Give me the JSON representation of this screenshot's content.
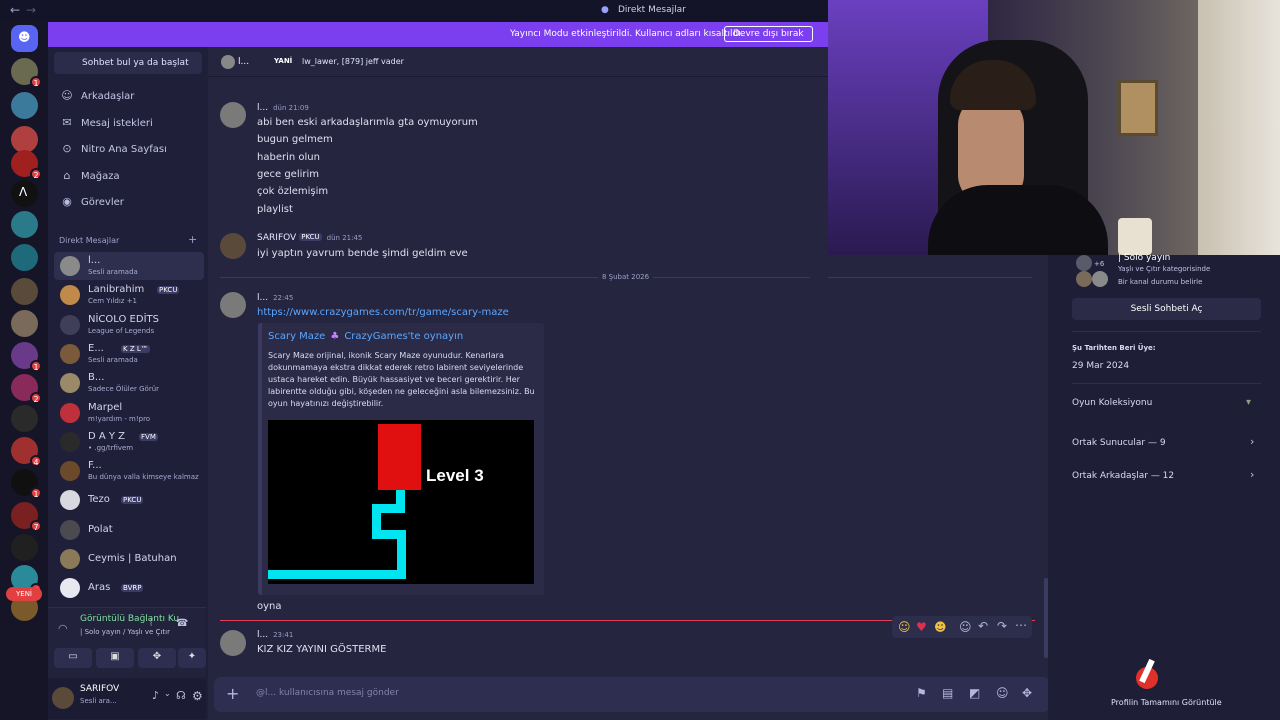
{
  "window": {
    "title": "Direkt Mesajlar"
  },
  "banner": {
    "text": "Yayıncı Modu etkinleştirildi. Kullanıcı adları kısaltıldı.",
    "button": "Devre dışı bırak"
  },
  "sidebar": {
    "search": "Sohbet bul ya da başlat",
    "nav": [
      {
        "label": "Arkadaşlar",
        "icon": "friends-icon",
        "glyph": "☺"
      },
      {
        "label": "Mesaj istekleri",
        "icon": "mail-icon",
        "glyph": "✉"
      },
      {
        "label": "Nitro Ana Sayfası",
        "icon": "nitro-icon",
        "glyph": "⊙"
      },
      {
        "label": "Mağaza",
        "icon": "shop-icon",
        "glyph": "⌂"
      },
      {
        "label": "Görevler",
        "icon": "quest-icon",
        "glyph": "◉"
      }
    ],
    "dm_header": "Direkt Mesajlar",
    "dm_add": "+",
    "dms": [
      {
        "name": "l...",
        "status": "Sesli aramada",
        "tag": "",
        "color": "#8a8a8a"
      },
      {
        "name": "Lanibrahim",
        "status": "Cem Yıldız +1",
        "tag": "PKCU",
        "color": "#c08a4a"
      },
      {
        "name": "NİCOLO EDİTS",
        "status": "League of Legends",
        "tag": "",
        "color": "#3f3f5a"
      },
      {
        "name": "E...",
        "status": "Sesli aramada",
        "tag": "K Z L™",
        "color": "#7a5a3a"
      },
      {
        "name": "B...",
        "status": "Sadece Ölüler Görür",
        "tag": "",
        "color": "#9a8a6a"
      },
      {
        "name": "Marpel",
        "status": "m!yardım - m!pro",
        "tag": "",
        "color": "#c0303a"
      },
      {
        "name": "D A Y Z",
        "status": "• .gg/trfivem",
        "tag": "FVM",
        "color": "#2a2a2a"
      },
      {
        "name": "F...",
        "status": "Bu dünya valla kimseye kalmaz",
        "tag": "",
        "color": "#6a4a2a"
      },
      {
        "name": "Tezo",
        "status": "",
        "tag": "PKCU",
        "color": "#d8d8e0"
      },
      {
        "name": "Polat",
        "status": "",
        "tag": "",
        "color": "#4a4a50"
      },
      {
        "name": "Ceymis | Batuhan",
        "status": "",
        "tag": "",
        "color": "#8a7a5a"
      },
      {
        "name": "Aras",
        "status": "",
        "tag": "BVRP",
        "color": "#e8e8f0"
      }
    ],
    "voice": {
      "title": "Görüntülü Bağlantı Ku",
      "sub": "| Solo yayın / Yaşlı ve Çıtır"
    },
    "user": {
      "name": "SARIFOV",
      "status": "Sesli ara..."
    },
    "new_badge": "YENİ"
  },
  "chat_header": {
    "user": "l...",
    "mode": "YANİ",
    "members": "lw_lawer, [879] jeff vader"
  },
  "messages": {
    "g1": {
      "name": "l...",
      "time": "dün 21:09",
      "lines": [
        "abi ben eski arkadaşlarımla gta oymuyorum",
        "bugun gelmem",
        "haberin olun",
        "gece gelirim",
        "çok özlemişim",
        "playlist"
      ]
    },
    "g2": {
      "name": "SARIFOV",
      "tag": "PKCU",
      "time": "dün 21:45",
      "lines": [
        "iyi yaptın yavrum bende şimdi geldim eve"
      ]
    },
    "divider": "8 Şubat 2026",
    "g3": {
      "name": "l...",
      "time": "22:45",
      "link": "https://www.crazygames.com/tr/game/scary-maze",
      "embed": {
        "title": "Scary Maze",
        "title2": "CrazyGames'te oynayın",
        "desc": [
          "Scary Maze orijinal, ikonik Scary Maze oyunudur. Kenarlara",
          "dokunmamaya ekstra dikkat ederek retro labirent seviyelerinde",
          "ustaca hareket edin. Büyük hassasiyet ve beceri gerektirir. Her",
          "labirentte olduğu gibi, köşeden ne geleceğini asla bilemezsiniz. Bu",
          "oyun hayatınızı değiştirebilir."
        ],
        "image_text": "Level 3"
      },
      "after": "oyna"
    },
    "g4": {
      "name": "l...",
      "time": "23:41",
      "lines": [
        "KIZ KIZ YAYINI GÖSTERME"
      ]
    }
  },
  "composer": {
    "placeholder": "@l... kullanıcısına mesaj gönder"
  },
  "profile": {
    "activity": "| Solo yayın",
    "category": "Yaşlı ve Çıtır kategorisinde",
    "note": "Bir kanal durumu belirle",
    "voice_button": "Sesli Sohbeti Aç",
    "member_since_label": "Şu Tarihten Beri Üye:",
    "member_since": "29 Mar 2024",
    "collection": "Oyun Koleksiyonu",
    "mutual_servers": "Ortak Sunucular — 9",
    "mutual_friends": "Ortak Arkadaşlar — 12",
    "full_profile": "Profilin Tamamını Görüntüle",
    "plus_count": "+6"
  },
  "colors": {
    "accent": "#7c3ff0",
    "link": "#5aa6ff",
    "embed_link": "#5aa6ff",
    "red": "#e01010",
    "cyan": "#00e5f0"
  }
}
